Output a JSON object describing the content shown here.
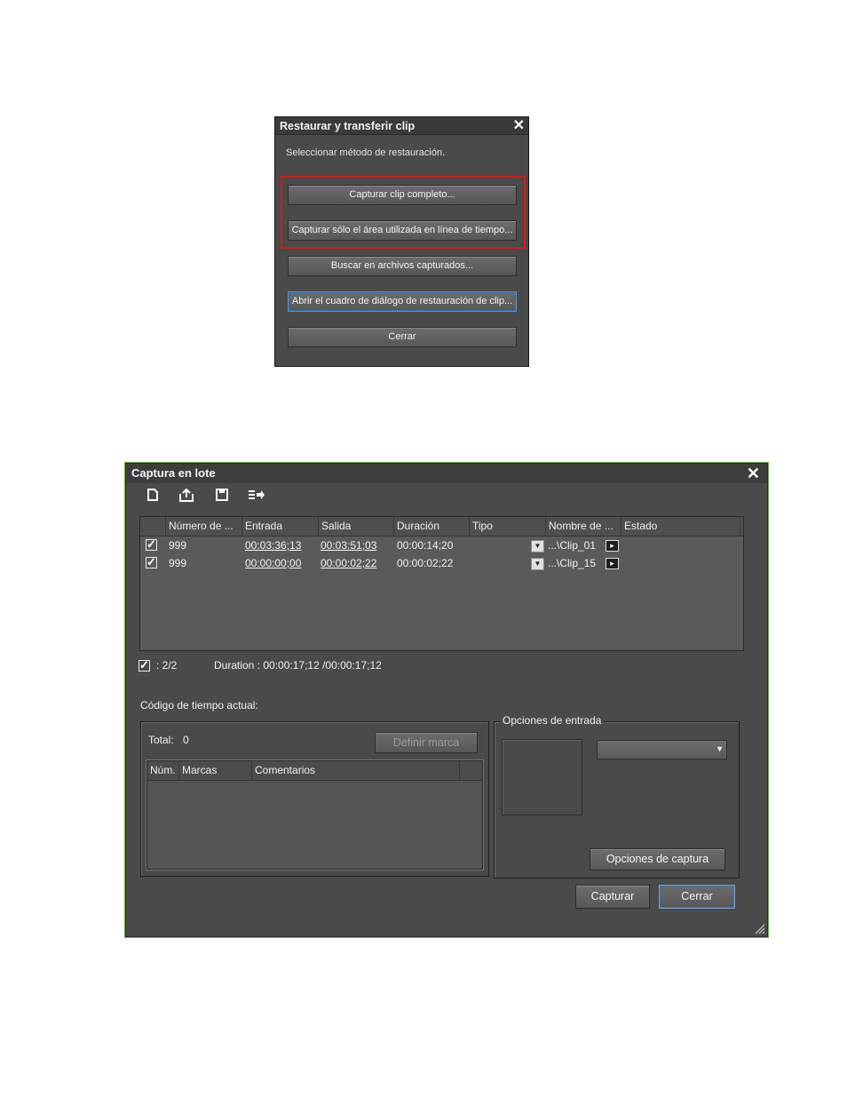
{
  "dialog1": {
    "title": "Restaurar y transferir clip",
    "close": "✕",
    "message": "Seleccionar método de restauración.",
    "buttons": [
      "Capturar clip completo...",
      "Capturar sólo el área utilizada en línea de tiempo...",
      "Buscar en archivos capturados...",
      "Abrir el cuadro de diálogo de restauración de clip...",
      "Cerrar"
    ]
  },
  "dialog2": {
    "title": "Captura en lote",
    "close": "✕",
    "toolbar": [
      "new-icon",
      "export-icon",
      "save-icon",
      "import-list-icon"
    ],
    "columns": [
      "Número de ...",
      "Entrada",
      "Salida",
      "Duración",
      "Tipo",
      "Nombre de ...",
      "Estado"
    ],
    "rows": [
      {
        "checked": true,
        "numero": "999",
        "entrada": "00:03:36;13",
        "salida": "00:03:51;03",
        "duracion": "00:00:14;20",
        "tipo": "",
        "nombre": "...\\Clip_01",
        "estado": ""
      },
      {
        "checked": true,
        "numero": "999",
        "entrada": "00:00:00;00",
        "salida": "00:00:02;22",
        "duracion": "00:00:02;22",
        "tipo": "",
        "nombre": "...\\Clip_15",
        "estado": ""
      }
    ],
    "summary_count": ": 2/2",
    "summary_duration": "Duration : 00:00:17;12 /00:00:17;12",
    "timecode_label": "Código de tiempo actual:",
    "total_label": "Total:",
    "total_value": "0",
    "define_mark": "Definir marca",
    "marks_columns": [
      "Núm.",
      "Marcas",
      "Comentarios"
    ],
    "input_options_legend": "Opciones de entrada",
    "input_select_value": "",
    "capture_options": "Opciones de captura",
    "capture_button": "Capturar",
    "close_button": "Cerrar"
  },
  "colors": {
    "highlight": "#d7191c",
    "dialog_bg": "#4a4a4a",
    "accent_border": "#6fae45"
  }
}
